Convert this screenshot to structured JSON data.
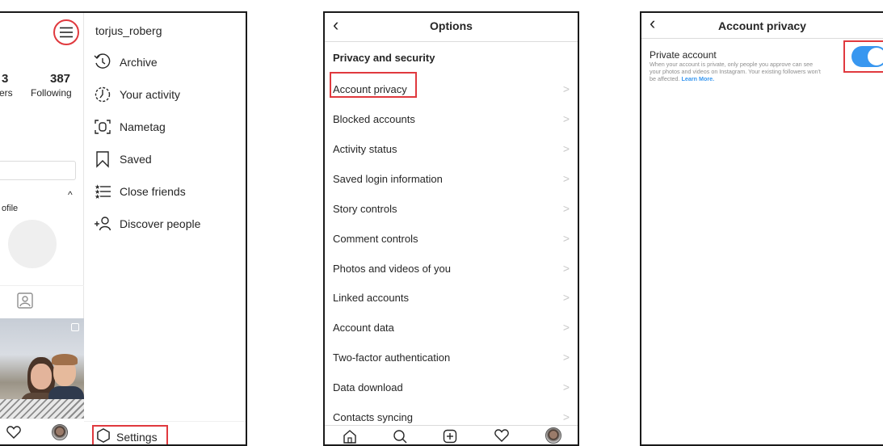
{
  "panel1": {
    "stats": {
      "followers_num_partial": "3",
      "followers_label_partial": "ers",
      "following_num": "387",
      "following_label": "Following"
    },
    "profile_partial_text": "ofile",
    "username": "torjus_roberg",
    "menu": [
      {
        "label": "Archive",
        "icon": "archive-icon"
      },
      {
        "label": "Your activity",
        "icon": "activity-icon"
      },
      {
        "label": "Nametag",
        "icon": "nametag-icon"
      },
      {
        "label": "Saved",
        "icon": "bookmark-icon"
      },
      {
        "label": "Close friends",
        "icon": "close-friends-icon"
      },
      {
        "label": "Discover people",
        "icon": "add-person-icon"
      }
    ],
    "settings_label": "Settings"
  },
  "panel2": {
    "title": "Options",
    "section": "Privacy and security",
    "items": [
      {
        "label": "Account privacy"
      },
      {
        "label": "Blocked accounts"
      },
      {
        "label": "Activity status"
      },
      {
        "label": "Saved login information"
      },
      {
        "label": "Story controls"
      },
      {
        "label": "Comment controls"
      },
      {
        "label": "Photos and videos of you"
      },
      {
        "label": "Linked accounts"
      },
      {
        "label": "Account data"
      },
      {
        "label": "Two-factor authentication"
      },
      {
        "label": "Data download"
      },
      {
        "label": "Contacts syncing"
      }
    ]
  },
  "panel3": {
    "title": "Account privacy",
    "private_label": "Private account",
    "description": "When your account is private, only people you approve can see your photos and videos on Instagram. Your existing followers won't be affected.",
    "learn_more": "Learn More.",
    "private_enabled": true
  },
  "colors": {
    "highlight": "#e0393e",
    "toggle_on": "#3897f0",
    "link": "#3897f0",
    "chevron": "#c7c7c7"
  }
}
